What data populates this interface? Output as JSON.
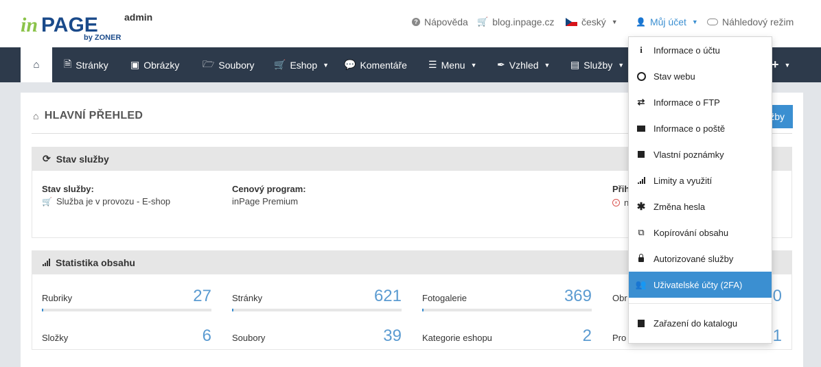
{
  "logo": {
    "brand": "inPAGE",
    "sub": "by ZONER",
    "badge": "admin"
  },
  "topnav": {
    "help": "Nápověda",
    "blog": "blog.inpage.cz",
    "language": "český",
    "account": "Můj účet",
    "preview": "Náhledový režim"
  },
  "nav": {
    "items": [
      {
        "label": "Stránky",
        "icon": "file-icon"
      },
      {
        "label": "Obrázky",
        "icon": "image-icon"
      },
      {
        "label": "Soubory",
        "icon": "folder-icon"
      },
      {
        "label": "Eshop",
        "icon": "cart-icon"
      },
      {
        "label": "Komentáře",
        "icon": "comments-icon"
      },
      {
        "label": "Menu",
        "icon": "list-icon"
      },
      {
        "label": "Vzhled",
        "icon": "brush-icon"
      },
      {
        "label": "Služby",
        "icon": "tasks-icon"
      }
    ],
    "plus": "+"
  },
  "page": {
    "title": "HLAVNÍ PŘEHLED",
    "button_fragment": "žby"
  },
  "service": {
    "heading": "Stav služby",
    "status_label": "Stav služby:",
    "status_value": "Služba je v provozu - E-shop",
    "plan_label": "Cenový program:",
    "plan_value": "inPage Premium",
    "third_label": "Přih",
    "third_value": "n"
  },
  "stats": {
    "heading": "Statistika obsahu",
    "rows": [
      [
        {
          "label": "Rubriky",
          "value": "27"
        },
        {
          "label": "Stránky",
          "value": "621"
        },
        {
          "label": "Fotogalerie",
          "value": "369"
        },
        {
          "label": "Obr",
          "value": "0"
        }
      ],
      [
        {
          "label": "Složky",
          "value": "6"
        },
        {
          "label": "Soubory",
          "value": "39"
        },
        {
          "label": "Kategorie eshopu",
          "value": "2"
        },
        {
          "label": "Pro",
          "value": "1"
        }
      ]
    ]
  },
  "account_menu": {
    "items": [
      {
        "label": "Informace o účtu",
        "icon": "info-icon"
      },
      {
        "label": "Stav webu",
        "icon": "gauge-icon"
      },
      {
        "label": "Informace o FTP",
        "icon": "transfer-icon"
      },
      {
        "label": "Informace o poště",
        "icon": "envelope-icon"
      },
      {
        "label": "Vlastní poznámky",
        "icon": "note-icon"
      },
      {
        "label": "Limity a využití",
        "icon": "signal-icon"
      },
      {
        "label": "Změna hesla",
        "icon": "asterisk-icon"
      },
      {
        "label": "Kopírování obsahu",
        "icon": "copy-icon"
      },
      {
        "label": "Autorizované služby",
        "icon": "lock-icon"
      },
      {
        "label": "Uživatelské účty (2FA)",
        "icon": "users-icon"
      },
      {
        "label": "Zařazení do katalogu",
        "icon": "book-icon"
      }
    ],
    "active_index": 9
  },
  "colors": {
    "navbar": "#2d3a4b",
    "accent": "#3b8fd1",
    "green": "#2db52d",
    "stat_value": "#5b9bd1"
  }
}
